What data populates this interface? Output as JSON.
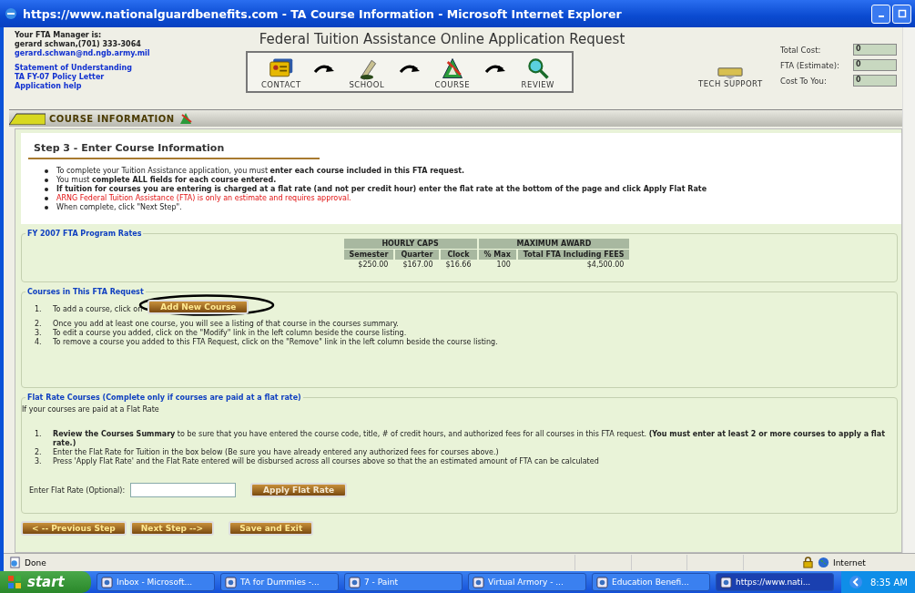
{
  "window": {
    "title": "https://www.nationalguardbenefits.com - TA Course Information - Microsoft Internet Explorer"
  },
  "manager": {
    "heading": "Your FTA Manager is:",
    "name": "gerard schwan,(701) 333-3064",
    "email": "gerard.schwan@nd.ngb.army.mil",
    "links": [
      "Statement of Understanding",
      "TA FY-07 Policy Letter",
      "Application help"
    ]
  },
  "page_title": "Federal Tuition Assistance Online Application Request",
  "steps": [
    {
      "label": "CONTACT",
      "kind": "contact"
    },
    {
      "label": "SCHOOL",
      "kind": "school"
    },
    {
      "label": "COURSE",
      "kind": "course"
    },
    {
      "label": "REVIEW",
      "kind": "review"
    }
  ],
  "tech_support": "TECH SUPPORT",
  "totals": [
    {
      "label": "Total Cost:",
      "value": "0"
    },
    {
      "label": "FTA (Estimate):",
      "value": "0"
    },
    {
      "label": "Cost To You:",
      "value": "0"
    }
  ],
  "section_bar": "COURSE INFORMATION",
  "step_heading": "Step 3 - Enter Course Information",
  "instructions": [
    {
      "text": "To complete your Tuition Assistance application, you must **enter each course included in this FTA request.**",
      "kind": "normal"
    },
    {
      "text": "You must **complete ALL fields for each course entered.**",
      "kind": "normal"
    },
    {
      "text": "If tuition for courses you are entering is charged at a flat rate (and not per credit hour) enter the flat rate at the bottom of the page and click Apply Flat Rate",
      "kind": "bold"
    },
    {
      "text": "ARNG Federal Tuition Assistance (FTA) is only an estimate and requires approval.",
      "kind": "warning"
    },
    {
      "text": "When complete, click \"Next Step\".",
      "kind": "normal"
    }
  ],
  "rates": {
    "legend": "FY 2007 FTA Program Rates",
    "groups": [
      "HOURLY CAPS",
      "MAXIMUM AWARD"
    ],
    "columns": [
      "Semester",
      "Quarter",
      "Clock",
      "% Max",
      "Total FTA Including FEES"
    ],
    "values": [
      "$250.00",
      "$167.00",
      "$16.66",
      "100",
      "$4,500.00"
    ]
  },
  "courses": {
    "legend": "Courses in This FTA Request",
    "items": [
      {
        "number": "1.",
        "text": "To add a course, click on"
      },
      {
        "number": "2.",
        "text": "Once you add at least one course, you will see a listing of that course in the courses summary."
      },
      {
        "number": "3.",
        "text": "To edit a course you added, click on the \"Modify\" link in the left column beside the course listing."
      },
      {
        "number": "4.",
        "text": "To remove a course you added to this FTA Request, click on the \"Remove\" link in the left column beside the course listing."
      }
    ],
    "add_button": "Add New Course"
  },
  "flat": {
    "legend": "Flat Rate Courses (Complete only if courses are paid at a flat rate)",
    "intro": "If your courses are paid at a Flat Rate",
    "items": [
      {
        "number": "1.",
        "text": "**Review the Courses Summary** to be sure that you have entered the course code, title, # of credit hours, and authorized fees for all courses in this FTA request. **(You must enter at least 2 or more courses to apply a flat rate.)**"
      },
      {
        "number": "2.",
        "text": "Enter the Flat Rate for Tuition in the box below (Be sure you have already entered any authorized fees for courses above.)"
      },
      {
        "number": "3.",
        "text": "Press 'Apply Flat Rate' and the Flat Rate entered will be disbursed across all courses above so that the an estimated amount of FTA can be calculated"
      }
    ],
    "field_label": "Enter Flat Rate (Optional):",
    "apply_button": "Apply Flat Rate"
  },
  "nav_buttons": [
    "< -- Previous Step",
    "Next Step -->",
    "Save and Exit"
  ],
  "status_bar": {
    "text": "Done",
    "zone": "Internet"
  },
  "taskbar": {
    "start": "start",
    "items": [
      {
        "label": "Inbox - Microsoft...",
        "selected": false
      },
      {
        "label": "TA for Dummies -...",
        "selected": false
      },
      {
        "label": "7 - Paint",
        "selected": false
      },
      {
        "label": "Virtual Armory - ...",
        "selected": false
      },
      {
        "label": "Education Benefi...",
        "selected": false
      },
      {
        "label": "https://www.nati...",
        "selected": true
      }
    ],
    "time": "8:35 AM"
  }
}
